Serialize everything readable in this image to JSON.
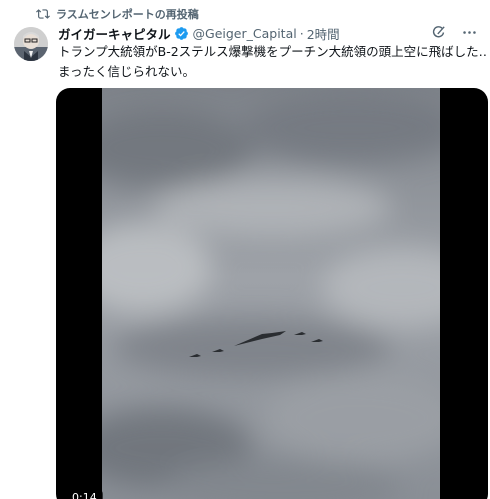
{
  "repost": {
    "label": "ラスムセンレポートの再投稿",
    "icon": "repost-icon"
  },
  "author": {
    "display_name": "ガイガーキャピタル",
    "handle": "@Geiger_Capital",
    "separator": "·",
    "time": "2時間",
    "verified": true,
    "verified_color": "#1d9bf0"
  },
  "tweet": {
    "line1": "トランプ大統領がB-2ステルス爆撃機をプーチン大統領の頭上空に飛ばした…",
    "line2": "まったく信じられない。"
  },
  "header_icons": [
    "grok-icon",
    "more-icon"
  ],
  "media": {
    "type": "video",
    "timestamp": "0:14"
  },
  "colors": {
    "text_primary": "#0f1419",
    "text_secondary": "#536471",
    "sky": "#8b9097"
  }
}
